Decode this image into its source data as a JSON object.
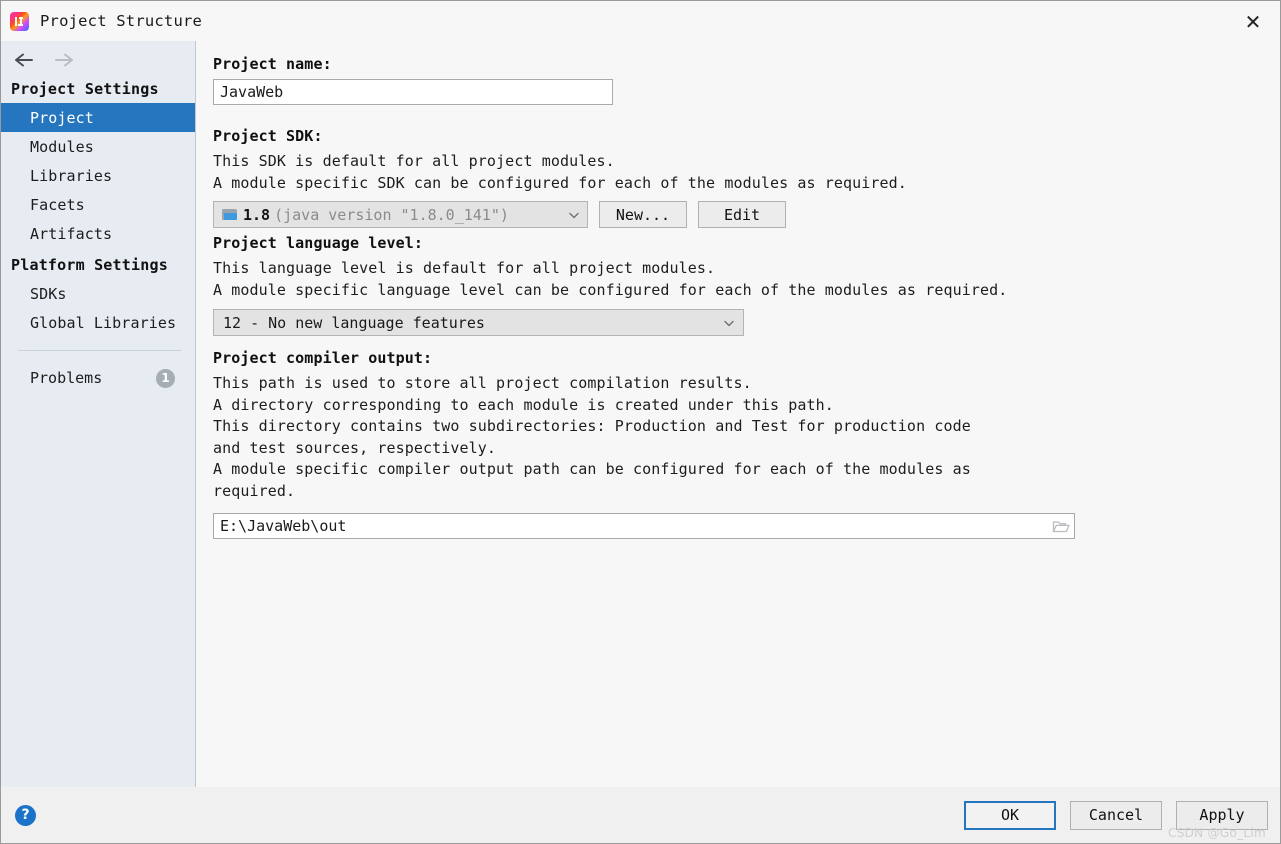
{
  "window": {
    "title": "Project Structure",
    "logo_icon": "intellij-idea-logo",
    "close_icon": "close-icon"
  },
  "sidebar": {
    "nav": {
      "back_icon": "arrow-left-icon",
      "forward_icon": "arrow-right-icon"
    },
    "sections": [
      {
        "title": "Project Settings",
        "items": [
          {
            "label": "Project",
            "selected": true
          },
          {
            "label": "Modules",
            "selected": false
          },
          {
            "label": "Libraries",
            "selected": false
          },
          {
            "label": "Facets",
            "selected": false
          },
          {
            "label": "Artifacts",
            "selected": false
          }
        ]
      },
      {
        "title": "Platform Settings",
        "items": [
          {
            "label": "SDKs",
            "selected": false
          },
          {
            "label": "Global Libraries",
            "selected": false
          }
        ]
      }
    ],
    "problems": {
      "label": "Problems",
      "count": "1"
    }
  },
  "main": {
    "project_name": {
      "label": "Project name:",
      "value": "JavaWeb",
      "placeholder": ""
    },
    "project_sdk": {
      "label": "Project SDK:",
      "description_lines": [
        "This SDK is default for all project modules.",
        "A module specific SDK can be configured for each of the modules as required."
      ],
      "combo": {
        "icon": "sdk-folder-icon",
        "version": "1.8",
        "detail": "(java version \"1.8.0_141\")",
        "caret_icon": "chevron-down-icon"
      },
      "new_button": "New...",
      "edit_button": "Edit"
    },
    "language_level": {
      "label": "Project language level:",
      "description_lines": [
        "This language level is default for all project modules.",
        "A module specific language level can be configured for each of the modules as required."
      ],
      "selected": "12 - No new language features",
      "caret_icon": "chevron-down-icon"
    },
    "compiler_output": {
      "label": "Project compiler output:",
      "description_lines": [
        "This path is used to store all project compilation results.",
        "A directory corresponding to each module is created under this path.",
        "This directory contains two subdirectories: Production and Test for production code",
        "and test sources, respectively.",
        "A module specific compiler output path can be configured for each of the modules as",
        "required."
      ],
      "value": "E:\\JavaWeb\\out",
      "browse_icon": "folder-open-icon"
    }
  },
  "footer": {
    "help_label": "?",
    "ok": "OK",
    "cancel": "Cancel",
    "apply": "Apply",
    "watermark": "CSDN @Go_Lim"
  },
  "colors": {
    "accent": "#2675bf",
    "sidebar_bg": "#e7ecf2",
    "panel_bg": "#f7f7f7",
    "footer_bg": "#f0f0f0",
    "help_blue": "#1a73c8",
    "badge_gray": "#a6adb4"
  }
}
